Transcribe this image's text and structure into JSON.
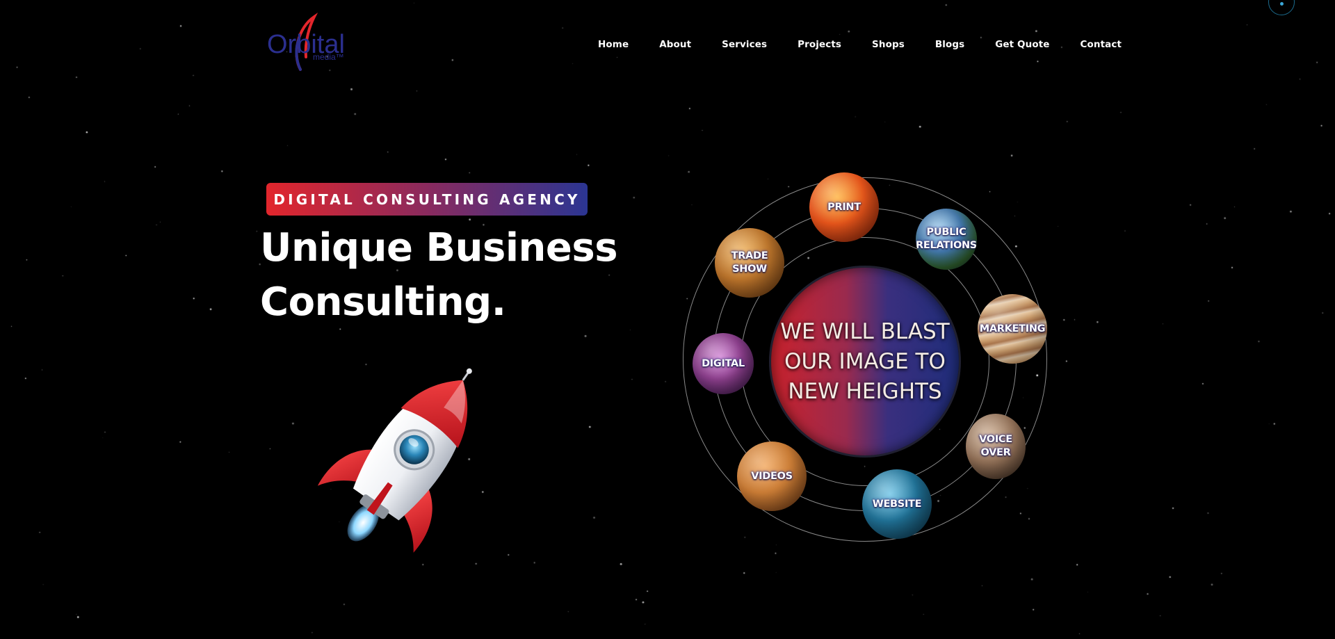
{
  "header": {
    "logo": {
      "text_main": "Orbital",
      "text_sub": "media™",
      "colors": {
        "blue": "#2b2f8f",
        "red": "#e3262c"
      }
    },
    "nav": [
      {
        "label": "Home"
      },
      {
        "label": "About"
      },
      {
        "label": "Services"
      },
      {
        "label": "Projects"
      },
      {
        "label": "Shops"
      },
      {
        "label": "Blogs"
      },
      {
        "label": "Get Quote"
      },
      {
        "label": "Contact"
      }
    ],
    "corner_button_icon": "circle-dot-icon"
  },
  "hero": {
    "badge": "DIGITAL CONSULTING AGENCY",
    "headline_line1": "Unique Business",
    "headline_line2": "Consulting.",
    "rocket_icon": "rocket-icon",
    "colors": {
      "badge_start": "#e2262c",
      "badge_end": "#2b3592"
    }
  },
  "orbit": {
    "center_lines": [
      "WE WILL BLAST",
      "OUR IMAGE TO",
      "NEW HEIGHTS"
    ],
    "planets": [
      {
        "label": "PRINT",
        "color": "#d9541c"
      },
      {
        "label": "PUBLIC\nRELATIONS",
        "color": "#2e5e8c"
      },
      {
        "label": "TRADE\nSHOW",
        "color": "#b8722a"
      },
      {
        "label": "MARKETING",
        "color": "#c89a6a"
      },
      {
        "label": "DIGITAL",
        "color": "#8a3e8a"
      },
      {
        "label": "VOICE\nOVER",
        "color": "#8a6a52"
      },
      {
        "label": "VIDEOS",
        "color": "#c77a34"
      },
      {
        "label": "WEBSITE",
        "color": "#1f6f93"
      }
    ]
  }
}
